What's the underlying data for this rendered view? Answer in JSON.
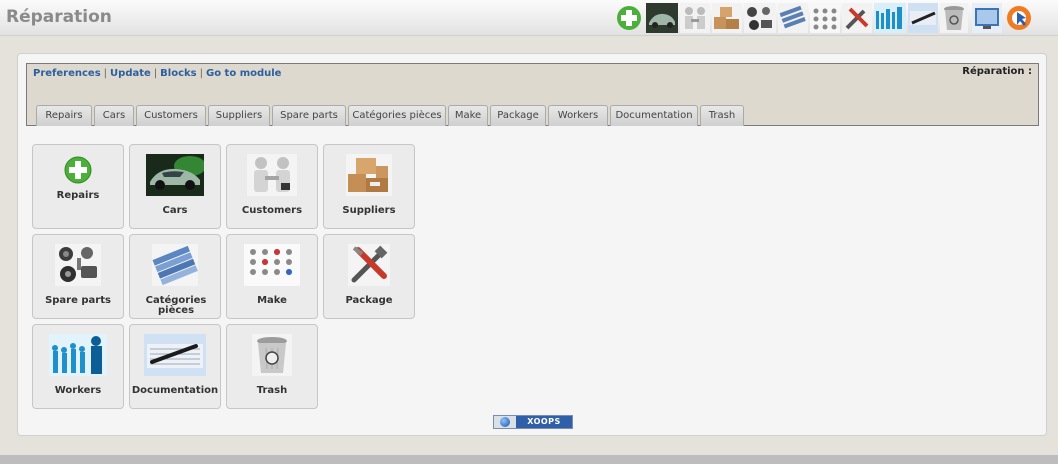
{
  "app": {
    "title": "Réparation"
  },
  "toolbar": {
    "icons": [
      "add-icon",
      "car-icon",
      "customers-icon",
      "suppliers-icon",
      "spare-parts-icon",
      "categories-icon",
      "make-icon",
      "package-icon",
      "workers-icon",
      "documentation-icon",
      "trash-icon",
      "preferences-icon",
      "update-icon"
    ]
  },
  "header": {
    "links": {
      "preferences": "Preferences",
      "update": "Update",
      "blocks": "Blocks",
      "goto": "Go to module"
    },
    "module_label": "Réparation :"
  },
  "tabs": [
    "Repairs",
    "Cars",
    "Customers",
    "Suppliers",
    "Spare parts",
    "Catégories pièces",
    "Make",
    "Package",
    "Workers",
    "Documentation",
    "Trash"
  ],
  "tiles": [
    {
      "label": "Repairs",
      "icon": "add-icon"
    },
    {
      "label": "Cars",
      "icon": "car-icon"
    },
    {
      "label": "Customers",
      "icon": "customers-icon"
    },
    {
      "label": "Suppliers",
      "icon": "suppliers-icon"
    },
    {
      "label": "Spare parts",
      "icon": "spare-parts-icon"
    },
    {
      "label": "Catégories pièces",
      "icon": "categories-icon"
    },
    {
      "label": "Make",
      "icon": "make-icon"
    },
    {
      "label": "Package",
      "icon": "package-icon"
    },
    {
      "label": "Workers",
      "icon": "workers-icon"
    },
    {
      "label": "Documentation",
      "icon": "documentation-icon"
    },
    {
      "label": "Trash",
      "icon": "trash-icon"
    }
  ],
  "footer": {
    "badge": "XOOPS"
  },
  "colors": {
    "link": "#2b5f9e",
    "accent": "#2f5fa8"
  }
}
